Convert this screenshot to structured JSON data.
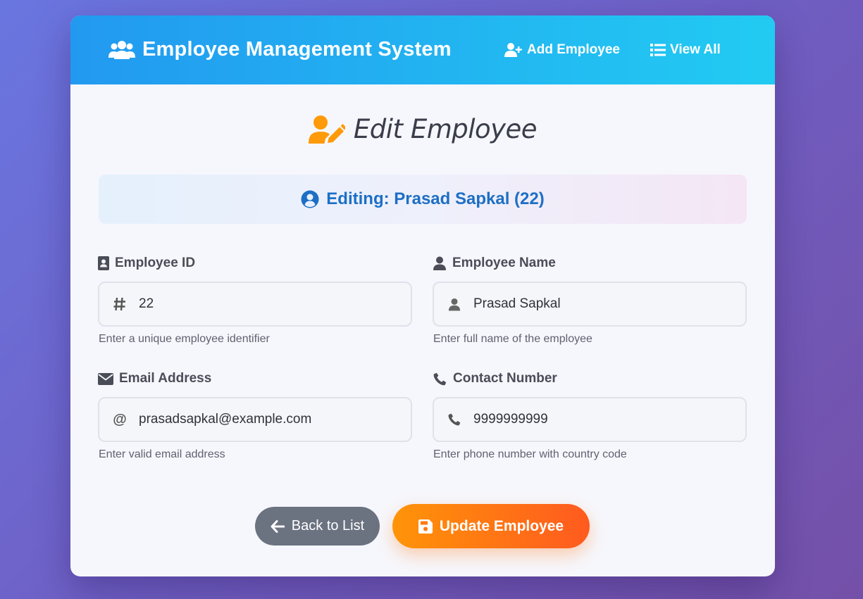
{
  "header": {
    "brand": "Employee Management System",
    "nav": [
      {
        "label": "Add Employee"
      },
      {
        "label": "View All"
      }
    ]
  },
  "page": {
    "title": "Edit Employee",
    "banner": "Editing: Prasad Sapkal (22)"
  },
  "form": {
    "employee_id": {
      "label": "Employee ID",
      "value": "22",
      "hint": "Enter a unique employee identifier"
    },
    "employee_name": {
      "label": "Employee Name",
      "value": "Prasad Sapkal",
      "hint": "Enter full name of the employee"
    },
    "email": {
      "label": "Email Address",
      "value": "prasadsapkal@example.com",
      "hint": "Enter valid email address"
    },
    "contact": {
      "label": "Contact Number",
      "value": "9999999999",
      "hint": "Enter phone number with country code"
    }
  },
  "actions": {
    "back_label": "Back to List",
    "update_label": "Update Employee"
  },
  "colors": {
    "header_start": "#2299f0",
    "header_end": "#22cbf2",
    "banner_text": "#1d6fc5",
    "title_icon": "#ff9a0a",
    "update_start": "#ff9408",
    "update_end": "#ff5a1f",
    "back_bg": "#6b7280"
  }
}
